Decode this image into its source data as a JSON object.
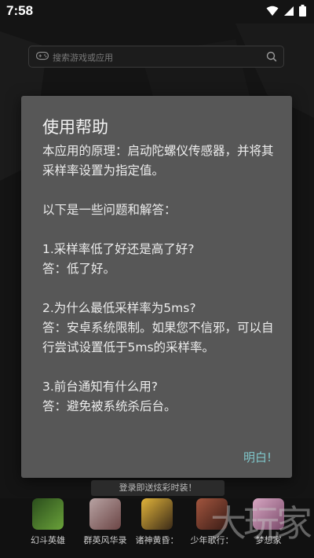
{
  "status_bar": {
    "time": "7:58",
    "icons": [
      "wifi-icon",
      "cellular-signal-icon",
      "battery-icon"
    ]
  },
  "search": {
    "placeholder": "搜索游戏或应用",
    "icon_left": "gamepad-icon",
    "icon_right": "search-icon"
  },
  "dialog": {
    "title": "使用帮助",
    "paragraphs": [
      "本应用的原理：启动陀螺仪传感器，并将其采样率设置为指定值。",
      "以下是一些问题和解答：",
      "1.采样率低了好还是高了好?",
      "答：低了好。",
      "2.为什么最低采样率为5ms?",
      "答：安卓系统限制。如果您不信邪，可以自行尝试设置低于5ms的采样率。",
      "3.前台通知有什么用?",
      "答：避免被系统杀后台。"
    ],
    "confirm_label": "明白!"
  },
  "promo_banner": "登录即送炫彩时装！",
  "games": [
    {
      "name": "幻斗英雄",
      "color": "#3d6b2a"
    },
    {
      "name": "群英风华录",
      "color": "#8a6a6a"
    },
    {
      "name": "诸神黄昏：",
      "color": "#c9a02a"
    },
    {
      "name": "少年歌行：",
      "color": "#7a3b2e"
    },
    {
      "name": "梦想家",
      "color": "#b07a9a"
    }
  ],
  "watermark": "大玩家",
  "colors": {
    "background": "#141414",
    "dialog_background": "#575757",
    "accent": "#7fc5c9"
  }
}
